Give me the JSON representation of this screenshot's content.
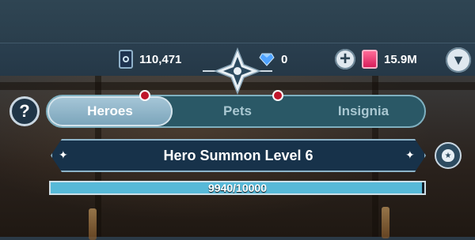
{
  "resources": {
    "cards": {
      "icon": "card-icon",
      "value": "110,471"
    },
    "gems": {
      "icon": "diamond-icon",
      "value": "0"
    },
    "rubies": {
      "icon": "ruby-icon",
      "value": "15.9M"
    }
  },
  "tabs": [
    {
      "label": "Heroes",
      "active": true,
      "badge": true
    },
    {
      "label": "Pets",
      "active": false,
      "badge": true
    },
    {
      "label": "Insignia",
      "active": false,
      "badge": false
    }
  ],
  "summon": {
    "title": "Hero Summon Level 6",
    "progress_text": "9940/10000",
    "progress_fraction": 0.994
  },
  "colors": {
    "accent": "#57b9d8",
    "badge": "#c0162a",
    "banner": "#17324a"
  }
}
